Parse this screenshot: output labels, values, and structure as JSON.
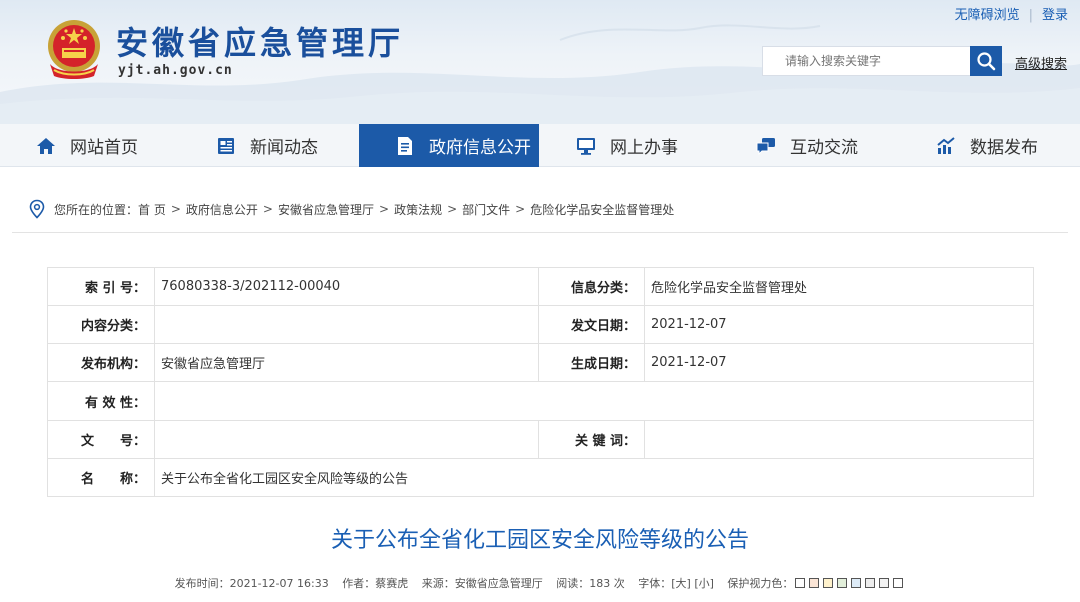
{
  "header": {
    "site_title": "安徽省应急管理厅",
    "site_domain": "yjt.ah.gov.cn",
    "top_links": {
      "accessible": "无障碍浏览",
      "login": "登录"
    },
    "search": {
      "placeholder": "请输入搜索关键字",
      "advanced_label": "高级搜索"
    }
  },
  "nav": {
    "items": [
      {
        "label": "网站首页",
        "icon": "home-icon"
      },
      {
        "label": "新闻动态",
        "icon": "news-icon"
      },
      {
        "label": "政府信息公开",
        "icon": "document-icon",
        "active": true
      },
      {
        "label": "网上办事",
        "icon": "monitor-icon"
      },
      {
        "label": "互动交流",
        "icon": "chat-icon"
      },
      {
        "label": "数据发布",
        "icon": "chart-icon"
      }
    ],
    "active_color": "#1c5aa8"
  },
  "breadcrumb": {
    "prefix": "您所在的位置：",
    "items": [
      "首 页",
      "政府信息公开",
      "安徽省应急管理厅",
      "政策法规",
      "部门文件",
      "危险化学品安全监督管理处"
    ],
    "separator": ">"
  },
  "info_table": {
    "index_label": "索 引 号：",
    "index_value": "76080338-3/202112-00040",
    "category_label": "信息分类：",
    "category_value": "危险化学品安全监督管理处",
    "content_type_label": "内容分类：",
    "content_type_value": "",
    "issue_date_label": "发文日期：",
    "issue_date_value": "2021-12-07",
    "publisher_label": "发布机构：",
    "publisher_value": "安徽省应急管理厅",
    "created_date_label": "生成日期：",
    "created_date_value": "2021-12-07",
    "validity_label": "有 效 性：",
    "validity_value": "",
    "doc_number_label": "文　　号：",
    "doc_number_value": "",
    "keywords_label": "关 键 词：",
    "keywords_value": "",
    "name_label": "名　　称：",
    "name_value": "关于公布全省化工园区安全风险等级的公告"
  },
  "article": {
    "title": "关于公布全省化工园区安全风险等级的公告",
    "meta": {
      "publish_time_label": "发布时间：",
      "publish_time": "2021-12-07 16:33",
      "author_label": "作者：",
      "author": "蔡赛虎",
      "source_label": "来源：",
      "source": "安徽省应急管理厅",
      "views_label": "阅读：",
      "views": "183 次",
      "font_label": "字体：",
      "font_large": "[大]",
      "font_small": "[小]",
      "eye_care_label": "保护视力色：",
      "eye_care_colors": [
        "#ffffff",
        "#fbe5d6",
        "#fff2cc",
        "#e2efda",
        "#ddebf7",
        "#ededed",
        "#f2f2f2",
        "#ffffff"
      ]
    }
  }
}
